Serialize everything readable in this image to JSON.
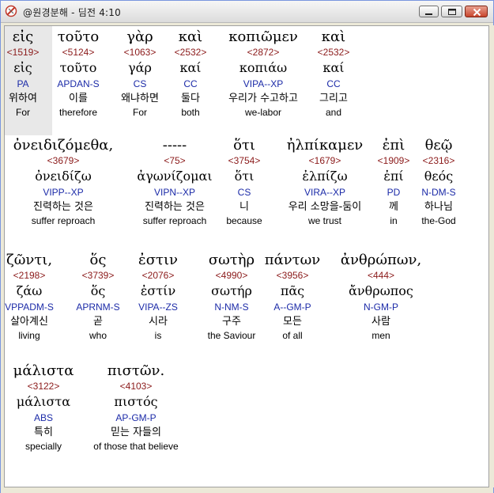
{
  "window": {
    "title": "@원경분해 - 딤전 4:10"
  },
  "rows": [
    {
      "words": [
        {
          "greek": "εἰς",
          "strong": "<1519>",
          "lemma": "εἰς",
          "parse": "PA",
          "korean": "위하여",
          "english": "For"
        },
        {
          "greek": "τοῦτο",
          "strong": "<5124>",
          "lemma": "τοῦτο",
          "parse": "APDAN-S",
          "korean": "이를",
          "english": "therefore"
        },
        {
          "greek": "γὰρ",
          "strong": "<1063>",
          "lemma": "γάρ",
          "parse": "CS",
          "korean": "왜냐하면",
          "english": "For"
        },
        {
          "greek": "καὶ",
          "strong": "<2532>",
          "lemma": "καί",
          "parse": "CC",
          "korean": "둘다",
          "english": "both"
        },
        {
          "greek": "κοπιῶμεν",
          "strong": "<2872>",
          "lemma": "κοπιάω",
          "parse": "VIPA--XP",
          "korean": "우리가 수고하고",
          "english": "we-labor"
        },
        {
          "greek": "καὶ",
          "strong": "<2532>",
          "lemma": "καί",
          "parse": "CC",
          "korean": "그리고",
          "english": "and"
        }
      ]
    },
    {
      "words": [
        {
          "greek": "ὀνειδιζόμεθα,",
          "strong": "<3679>",
          "lemma": "ὀνειδίζω",
          "parse": "VIPP--XP",
          "korean": "진력하는 것은",
          "english": "suffer reproach"
        },
        {
          "greek": "-----",
          "strong": "<75>",
          "lemma": "ἀγωνίζομαι",
          "parse": "VIPN--XP",
          "korean": "진력하는 것은",
          "english": "suffer reproach"
        },
        {
          "greek": "ὅτι",
          "strong": "<3754>",
          "lemma": "ὅτι",
          "parse": "CS",
          "korean": "니",
          "english": "because"
        },
        {
          "greek": "ἠλπίκαμεν",
          "strong": "<1679>",
          "lemma": "ἐλπίζω",
          "parse": "VIRA--XP",
          "korean": "우리 소망을-둠이",
          "english": "we trust"
        },
        {
          "greek": "ἐπὶ",
          "strong": "<1909>",
          "lemma": "ἐπί",
          "parse": "PD",
          "korean": "께",
          "english": "in"
        },
        {
          "greek": "θεῷ",
          "strong": "<2316>",
          "lemma": "θεός",
          "parse": "N-DM-S",
          "korean": "하나님",
          "english": "the-God"
        }
      ]
    },
    {
      "words": [
        {
          "greek": "ζῶντι,",
          "strong": "<2198>",
          "lemma": "ζάω",
          "parse": "VPPADM-S",
          "korean": "살아계신",
          "english": "living"
        },
        {
          "greek": "ὅς",
          "strong": "<3739>",
          "lemma": "ὅς",
          "parse": "APRNM-S",
          "korean": "곧",
          "english": "who"
        },
        {
          "greek": "ἐστιν",
          "strong": "<2076>",
          "lemma": "ἐστίν",
          "parse": "VIPA--ZS",
          "korean": "시라",
          "english": "is"
        },
        {
          "greek": "σωτὴρ",
          "strong": "<4990>",
          "lemma": "σωτήρ",
          "parse": "N-NM-S",
          "korean": "구주",
          "english": "the Saviour"
        },
        {
          "greek": "πάντων",
          "strong": "<3956>",
          "lemma": "πᾶς",
          "parse": "A--GM-P",
          "korean": "모든",
          "english": "of all"
        },
        {
          "greek": "ἀνθρώπων,",
          "strong": "<444>",
          "lemma": "ἄνθρωπος",
          "parse": "N-GM-P",
          "korean": "사람",
          "english": "men"
        }
      ]
    },
    {
      "words": [
        {
          "greek": "μάλιστα",
          "strong": "<3122>",
          "lemma": "μάλιστα",
          "parse": "ABS",
          "korean": "특히",
          "english": "specially"
        },
        {
          "greek": "πιστῶν.",
          "strong": "<4103>",
          "lemma": "πιστός",
          "parse": "AP-GM-P",
          "korean": "믿는 자들의",
          "english": "of those that believe"
        }
      ]
    }
  ]
}
